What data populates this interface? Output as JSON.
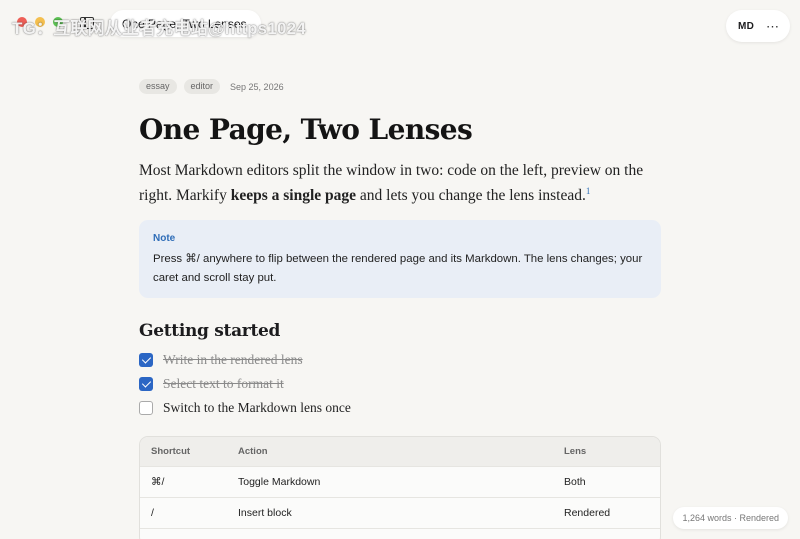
{
  "watermark": "TG：互联网从业者充电站@https1024",
  "window": {
    "title": "One Page, Two Lenses",
    "mode_toggle": "MD",
    "more_icon": "more-icon"
  },
  "meta": {
    "tags": [
      "essay",
      "editor"
    ],
    "date": "Sep 25, 2026"
  },
  "doc": {
    "title": "One Page, Two Lenses",
    "lead_part1": "Most Markdown editors split the window in two: code on the left, preview on the right. Markify ",
    "lead_bold": "keeps a single page",
    "lead_part2": " and lets you change the lens instead.",
    "footnote": "1",
    "callout": {
      "label": "Note",
      "text": "Press ⌘/ anywhere to flip between the rendered page and its Markdown. The lens changes; your caret and scroll stay put."
    },
    "section_title": "Getting started",
    "tasks": [
      {
        "label": "Write in the rendered lens",
        "done": true
      },
      {
        "label": "Select text to format it",
        "done": true
      },
      {
        "label": "Switch to the Markdown lens once",
        "done": false
      }
    ],
    "table": {
      "headers": [
        "Shortcut",
        "Action",
        "Lens"
      ],
      "rows": [
        [
          "⌘/",
          "Toggle Markdown",
          "Both"
        ],
        [
          "/",
          "Insert block",
          "Rendered"
        ]
      ]
    }
  },
  "status": "1,264 words · Rendered",
  "colors": {
    "accent": "#2b66c4",
    "callout_bg": "#e9eef6",
    "background": "#f7f6f3"
  }
}
